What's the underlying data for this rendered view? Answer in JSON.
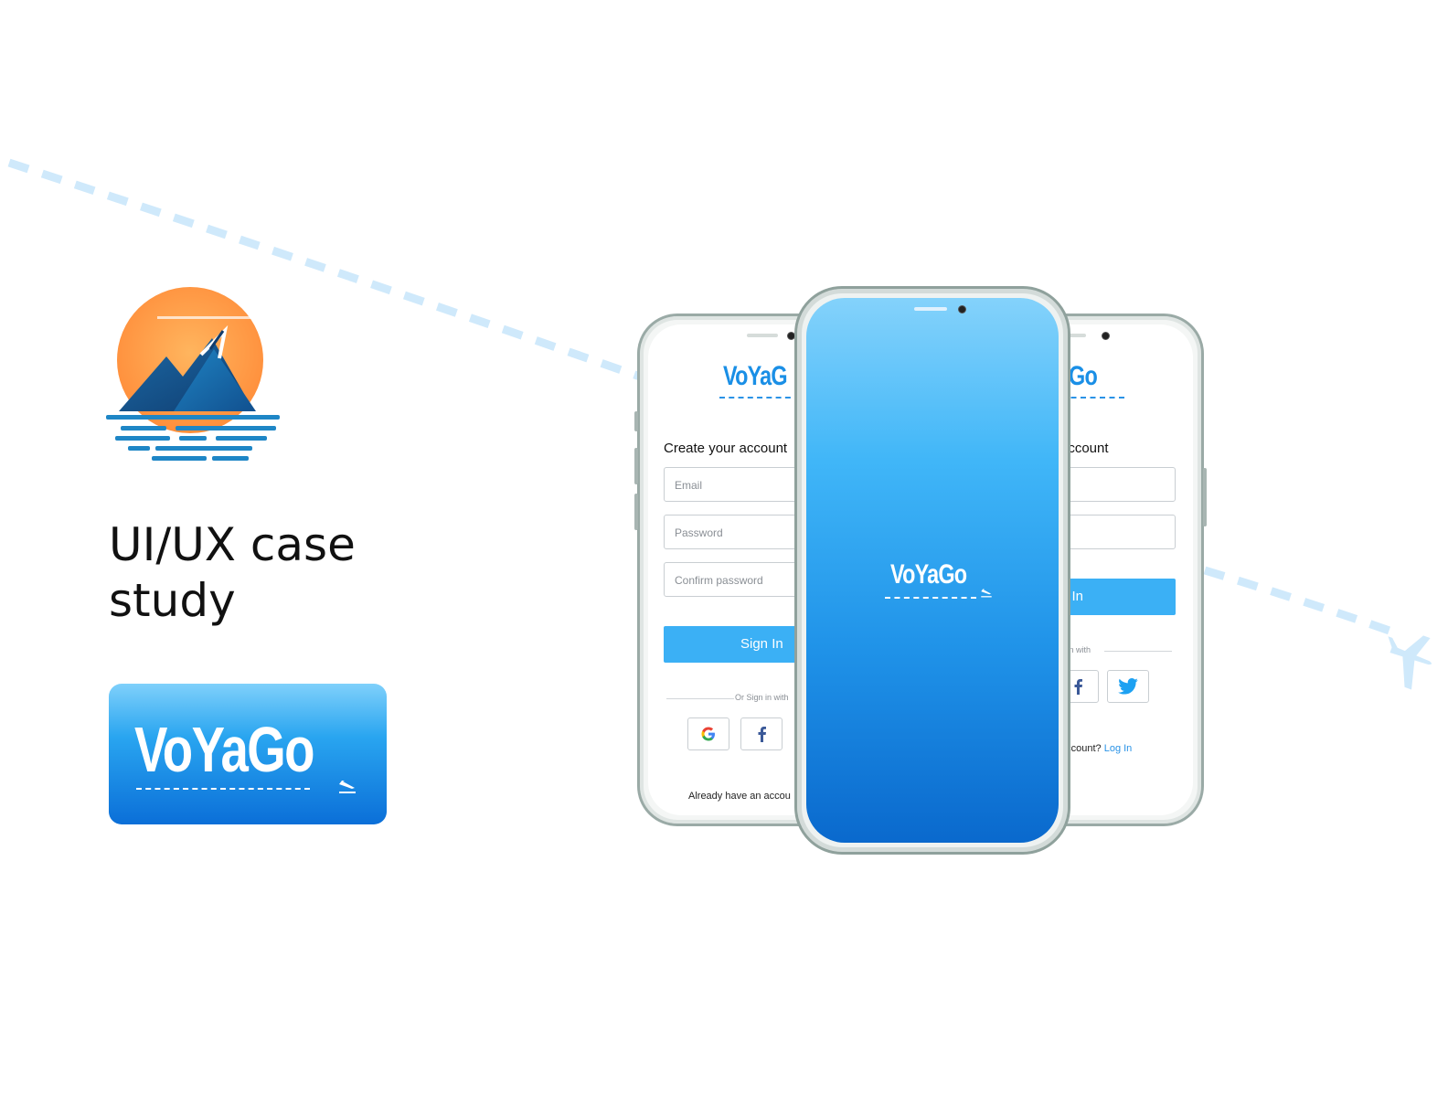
{
  "hero": {
    "title": "UI/UX case study",
    "wordmark": "VoYaGo"
  },
  "phone_left": {
    "logo": "VoYaG",
    "heading": "Create your account",
    "email_placeholder": "Email",
    "password_placeholder": "Password",
    "confirm_placeholder": "Confirm password",
    "sign_in_label": "Sign In",
    "divider_label": "Or Sign in with",
    "footer_text": "Already have an accou"
  },
  "phone_center": {
    "splash_logo": "VoYaGo"
  },
  "phone_right": {
    "logo": "'aGo",
    "heading": "account",
    "sign_in_label": "n In",
    "divider_label": "n in with",
    "footer_text": "account?",
    "footer_link": "Log In"
  },
  "colors": {
    "brand_blue": "#1a8fe6",
    "button_blue": "#3bb0f5",
    "flight_path": "#cfe9fb"
  },
  "icons": [
    "brand-logo-icon",
    "plane-icon",
    "google-icon",
    "facebook-icon",
    "twitter-icon"
  ]
}
